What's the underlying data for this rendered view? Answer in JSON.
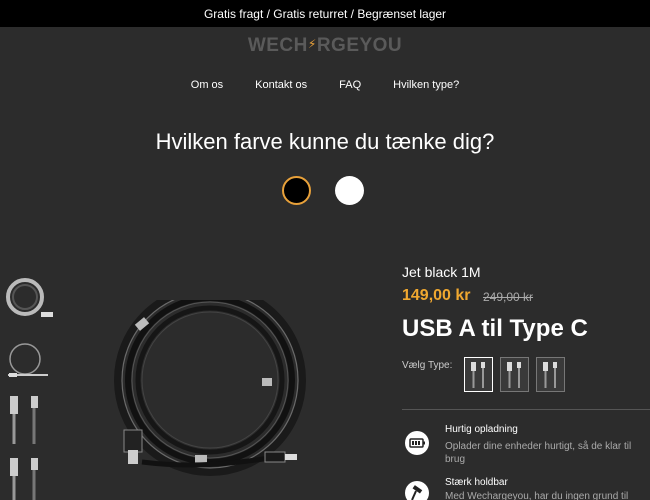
{
  "announcement": "Gratis fragt / Gratis returret / Begrænset lager",
  "brand": {
    "before": "WECH",
    "after": "RGEYOU",
    "bolt": "⚡",
    "accent": "#e8a13a"
  },
  "nav": [
    {
      "label": "Om os"
    },
    {
      "label": "Kontakt os"
    },
    {
      "label": "FAQ"
    },
    {
      "label": "Hvilken type?"
    }
  ],
  "color_question": "Hvilken farve kunne du tænke dig?",
  "colors": [
    {
      "name": "black",
      "hex": "#000000",
      "selected": true
    },
    {
      "name": "white",
      "hex": "#ffffff",
      "selected": false
    }
  ],
  "product": {
    "variant": "Jet black 1M",
    "price": "149,00 kr",
    "old_price": "249,00 kr",
    "title": "USB A til Type C",
    "type_label": "Vælg Type:"
  },
  "features": [
    {
      "icon": "battery-icon",
      "title": "Hurtig opladning",
      "desc": "Oplader dine enheder hurtigt, så de klar til brug"
    },
    {
      "icon": "hammer-icon",
      "title": "Stærk holdbar",
      "desc": "Med Wechargeyou, har du ingen grund til"
    }
  ]
}
